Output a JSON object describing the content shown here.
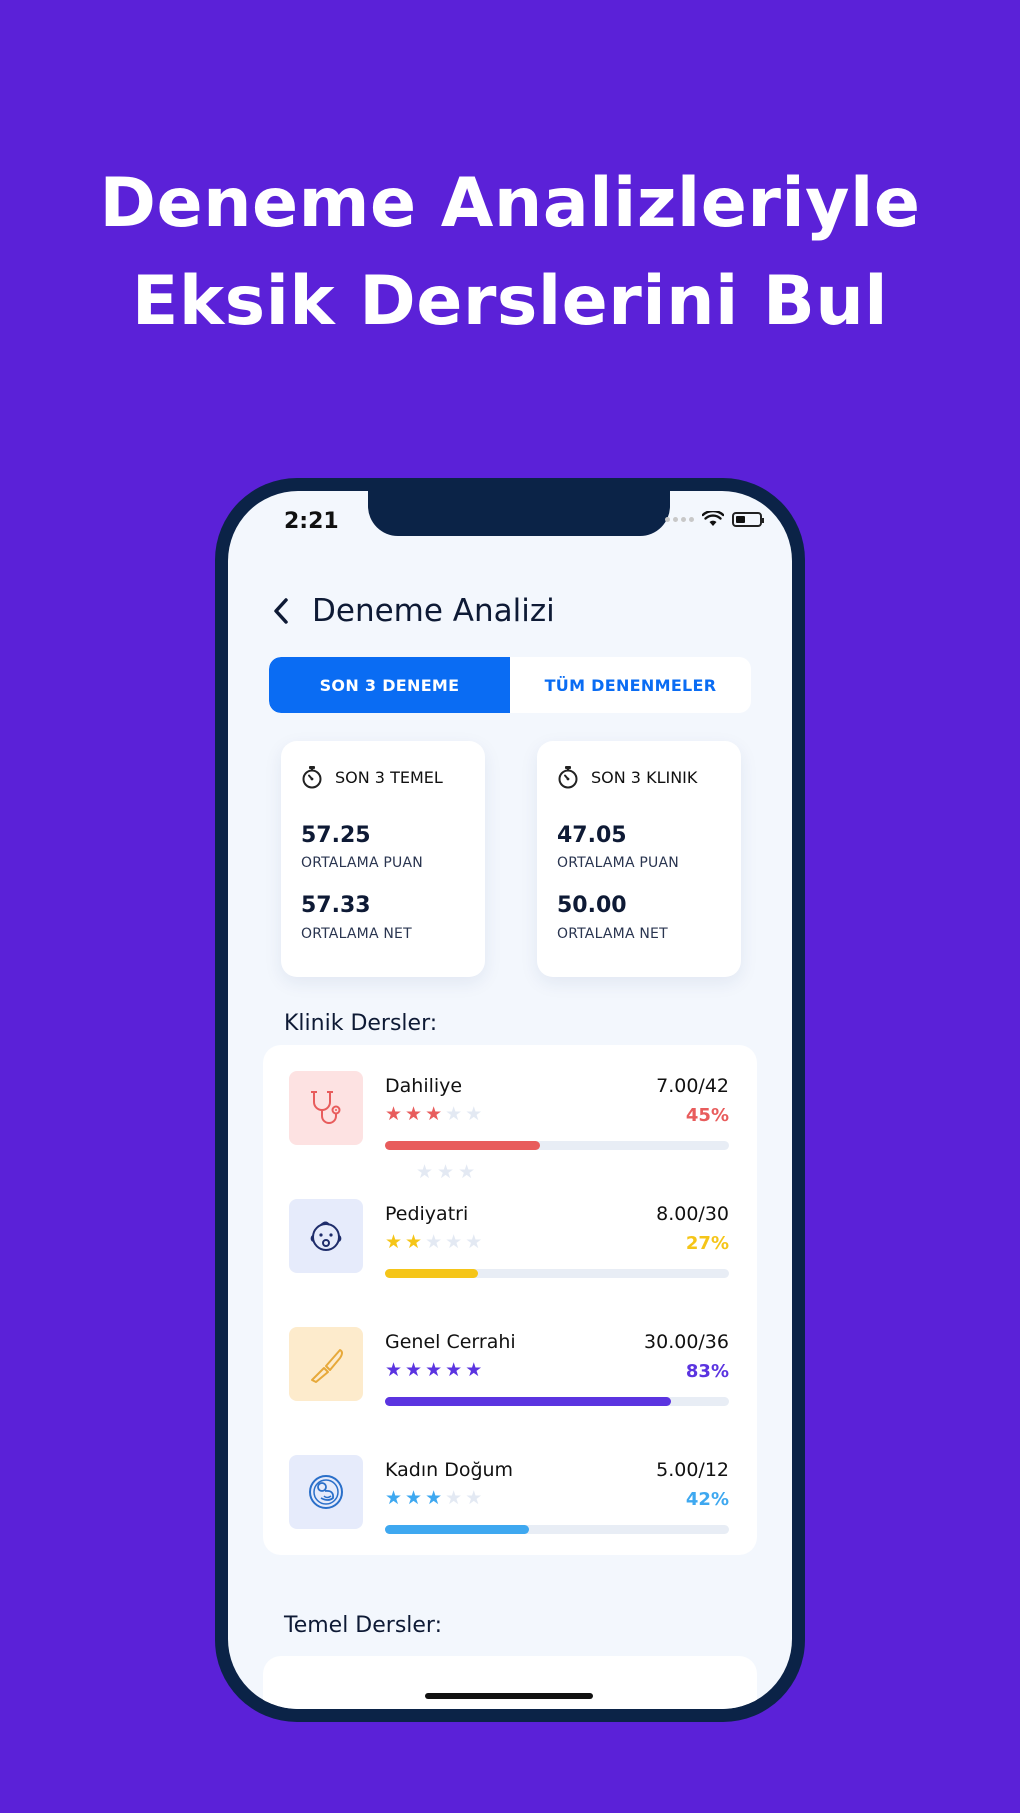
{
  "headline": {
    "line1": "Deneme Analizleriyle",
    "line2": "Eksik Derslerini Bul"
  },
  "status_bar": {
    "time": "2:21"
  },
  "nav": {
    "back_icon": "chevron-left-icon",
    "title": "Deneme Analizi"
  },
  "tabs": [
    {
      "label": "SON 3 DENEME",
      "active": true
    },
    {
      "label": "TÜM DENENMELER",
      "active": false
    }
  ],
  "summary_cards": [
    {
      "icon": "stopwatch-icon",
      "title": "SON 3 TEMEL",
      "puan_value": "57.25",
      "puan_label": "ORTALAMA PUAN",
      "net_value": "57.33",
      "net_label": "ORTALAMA NET"
    },
    {
      "icon": "stopwatch-icon",
      "title": "SON 3 KLINIK",
      "puan_value": "47.05",
      "puan_label": "ORTALAMA PUAN",
      "net_value": "50.00",
      "net_label": "ORTALAMA NET"
    }
  ],
  "klinik_section_title": "Klinik Dersler:",
  "temel_section_title": "Temel Dersler:",
  "klinik_dersler": [
    {
      "name": "Dahiliye",
      "score": "7.00/42",
      "percent_label": "45%",
      "progress": 0.45,
      "stars": 3,
      "color": "#e85c5c",
      "icon": "stethoscope-icon",
      "icon_bg": "#fde2e2"
    },
    {
      "name": "Pediyatri",
      "score": "8.00/30",
      "percent_label": "27%",
      "progress": 0.27,
      "stars": 2,
      "color": "#f5c518",
      "icon": "baby-face-icon",
      "icon_bg": "#e6ebfb"
    },
    {
      "name": "Genel Cerrahi",
      "score": "30.00/36",
      "percent_label": "83%",
      "progress": 0.83,
      "stars": 5,
      "color": "#5b34e0",
      "icon": "scalpel-icon",
      "icon_bg": "#fdebcc"
    },
    {
      "name": "Kadın Doğum",
      "score": "5.00/12",
      "percent_label": "42%",
      "progress": 0.42,
      "stars": 3,
      "color": "#3ea8f0",
      "icon": "fetus-icon",
      "icon_bg": "#e6ebfb"
    }
  ],
  "colors": {
    "background": "#5b21d8",
    "accent_blue": "#0a6cf3",
    "star_empty": "#e3e9f3"
  }
}
